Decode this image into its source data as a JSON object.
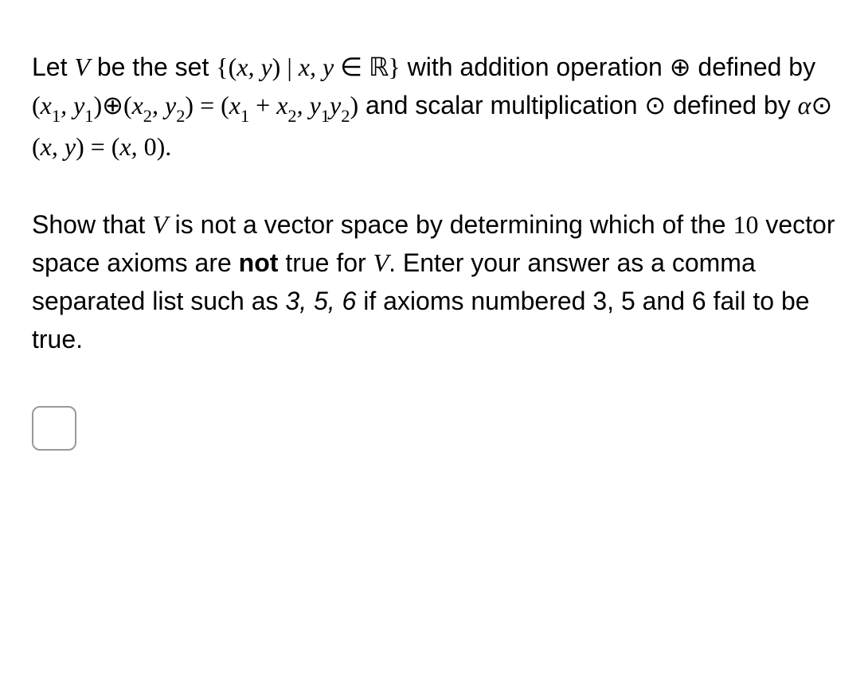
{
  "para1": {
    "t1": "Let ",
    "V": "V",
    "t2": " be the set ",
    "lbrace": "{",
    "lparen1": "(",
    "x": "x",
    "comma1": ", ",
    "y": "y",
    "rparen1": ")",
    "bar": " | ",
    "x2": "x",
    "comma2": ", ",
    "y2": "y",
    "in": " ∈ ",
    "R": "ℝ",
    "rbrace": "}",
    "t3": " with addition operation ",
    "oplus1": "⊕",
    "t4": " defined by",
    "eq_lparen1": "(",
    "eq_x1": "x",
    "eq_sub1": "1",
    "eq_comma1": ", ",
    "eq_y1": "y",
    "eq_suby1": "1",
    "eq_rparen1": ")",
    "eq_oplus": " ⊕ ",
    "eq_lparen2": "(",
    "eq_x2": "x",
    "eq_sub2": "2",
    "eq_comma2": ", ",
    "eq_y2": "y",
    "eq_suby2": "2",
    "eq_rparen2": ")",
    "eq_equals": " = ",
    "eq_lparen3": "(",
    "eq_x1b": "x",
    "eq_sub1b": "1",
    "eq_plus": " + ",
    "eq_x2b": "x",
    "eq_sub2b": "2",
    "eq_comma3": ", ",
    "eq_y1b": "y",
    "eq_suby1b": "1",
    "eq_y2b": "y",
    "eq_suby2b": "2",
    "eq_rparen3": ")",
    "t5": " and scalar multiplication ",
    "odot1": "⊙",
    "t6": " defined by ",
    "sm_alpha": "α",
    "sm_odot": " ⊙ ",
    "sm_lparen1": "(",
    "sm_x": "x",
    "sm_comma1": ", ",
    "sm_y": "y",
    "sm_rparen1": ")",
    "sm_equals": " = ",
    "sm_lparen2": "(",
    "sm_x2": "x",
    "sm_comma2": ", ",
    "sm_zero": "0",
    "sm_rparen2": ")",
    "sm_period": "."
  },
  "para2": {
    "t1": "Show that ",
    "V": "V",
    "t2": " is not a vector space by determining which of the ",
    "ten": "10",
    "t3": " vector space axioms are ",
    "not": "not",
    "t4": " true for ",
    "V2": "V",
    "t5": ". Enter your answer as a comma separated list such as ",
    "example": "3, 5, 6",
    "t6": " if axioms numbered 3, 5 and 6 fail to be true."
  },
  "input": {
    "value": ""
  }
}
